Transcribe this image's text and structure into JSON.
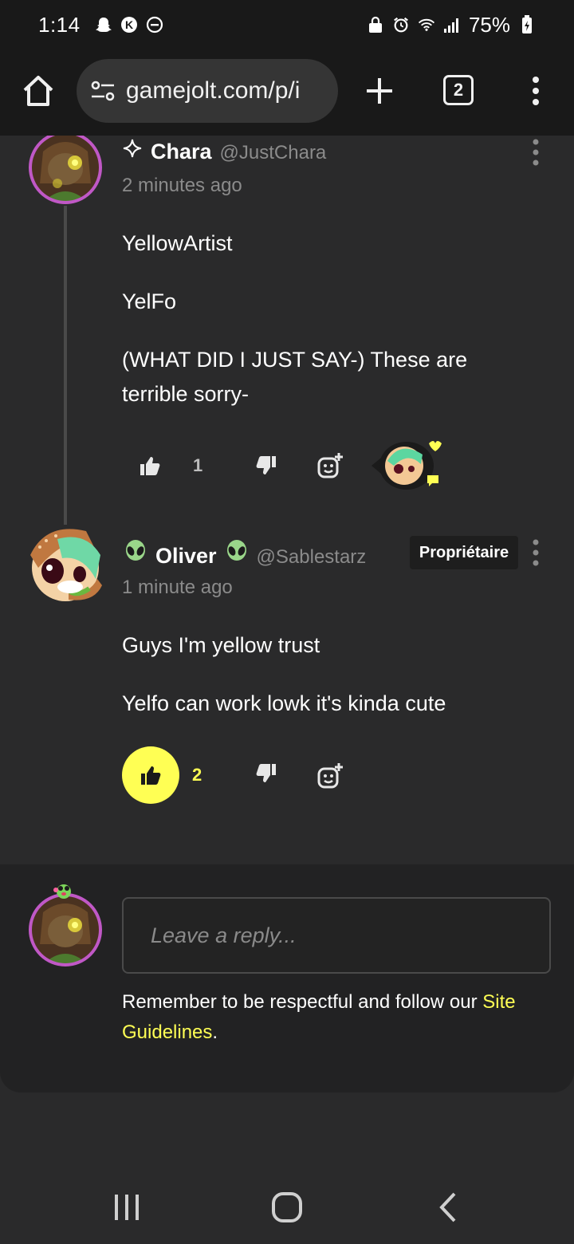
{
  "status_bar": {
    "time": "1:14",
    "battery": "75%"
  },
  "browser": {
    "url": "gamejolt.com/p/i",
    "tab_count": "2"
  },
  "comments": [
    {
      "author": "Chara",
      "handle": "@JustChara",
      "time": "2 minutes ago",
      "paragraphs": [
        "YellowArtist",
        "YelFo",
        "(WHAT DID I JUST SAY-) These are terrible sorry-"
      ],
      "likes": "1",
      "liked": false
    },
    {
      "author": "Oliver",
      "handle": "@Sablestarz",
      "badge": "Propriétaire",
      "time": "1 minute ago",
      "paragraphs": [
        "Guys I'm yellow trust",
        "Yelfo can work lowk it's kinda cute"
      ],
      "likes": "2",
      "liked": true
    }
  ],
  "reply": {
    "placeholder": "Leave a reply...",
    "guidelines_text": "Remember to be respectful and follow our",
    "guidelines_link": "Site Guidelines",
    "guidelines_end": "."
  },
  "colors": {
    "accent": "#ffff54",
    "ring": "#c058c6",
    "background": "#2a2a2b"
  },
  "icons": [
    "home-icon",
    "site-settings-icon",
    "plus-icon",
    "kebab-menu-icon",
    "thumbs-up-icon",
    "thumbs-down-icon",
    "add-sticker-icon",
    "alien-icon",
    "sparkle-icon"
  ]
}
